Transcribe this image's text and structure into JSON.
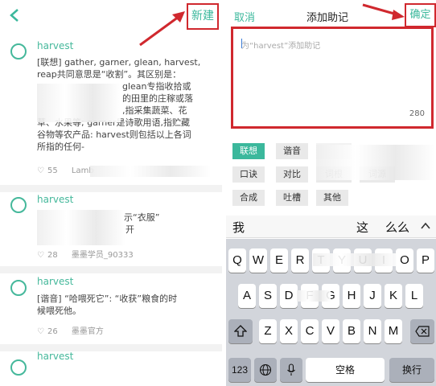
{
  "left": {
    "new_label": "新建",
    "cards": [
      {
        "title": "harvest",
        "body_lines": [
          "[联想] gather, garner, glean, harvest,",
          "reap共同意思是“收割”。其区别是：",
          "glean专指收拾或",
          "的田里的庄稼或落",
          ",指采集蔬菜、花",
          "草、水果等; garner是诗歌用语,指贮藏",
          "谷物等农产品: harvest则包括以上各词",
          "所指的任何-"
        ],
        "likes": "55",
        "author": "Lamb"
      },
      {
        "title": "harvest",
        "body_lines": [
          "示“衣服”",
          "开"
        ],
        "likes": "28",
        "author": "墨墨学员_90333"
      },
      {
        "title": "harvest",
        "body_lines": [
          "[谐音] “哈喂死它”: “收获”粮食的时",
          "候喂死他。"
        ],
        "likes": "26",
        "author": "墨墨官方"
      },
      {
        "title": "harvest",
        "body_lines": [],
        "likes": "",
        "author": ""
      }
    ]
  },
  "right": {
    "cancel_label": "取消",
    "title": "添加助记",
    "confirm_label": "确定",
    "placeholder": "为“harvest”添加助记",
    "counter": "280",
    "tags": [
      "联想",
      "谐音",
      "口诀",
      "对比",
      "词根",
      "词源",
      "合成",
      "吐槽",
      "其他"
    ],
    "candidates": [
      "我",
      "这",
      "么么"
    ],
    "keyboard": {
      "row1": [
        "Q",
        "W",
        "E",
        "R",
        "T",
        "Y",
        "U",
        "I",
        "O",
        "P"
      ],
      "row2": [
        "A",
        "S",
        "D",
        "F",
        "G",
        "H",
        "J",
        "K",
        "L"
      ],
      "row3": [
        "Z",
        "X",
        "C",
        "V",
        "B",
        "N",
        "M"
      ],
      "num_label": "123",
      "space_label": "空格",
      "return_label": "换行"
    }
  },
  "colors": {
    "accent": "#3bb89c",
    "highlight": "#d0282e"
  },
  "icons": [
    "back-chevron-icon",
    "circle-check-icon",
    "heart-icon",
    "arrow-icon",
    "shift-icon",
    "backspace-icon",
    "globe-icon",
    "mic-icon",
    "chevron-up-icon"
  ]
}
